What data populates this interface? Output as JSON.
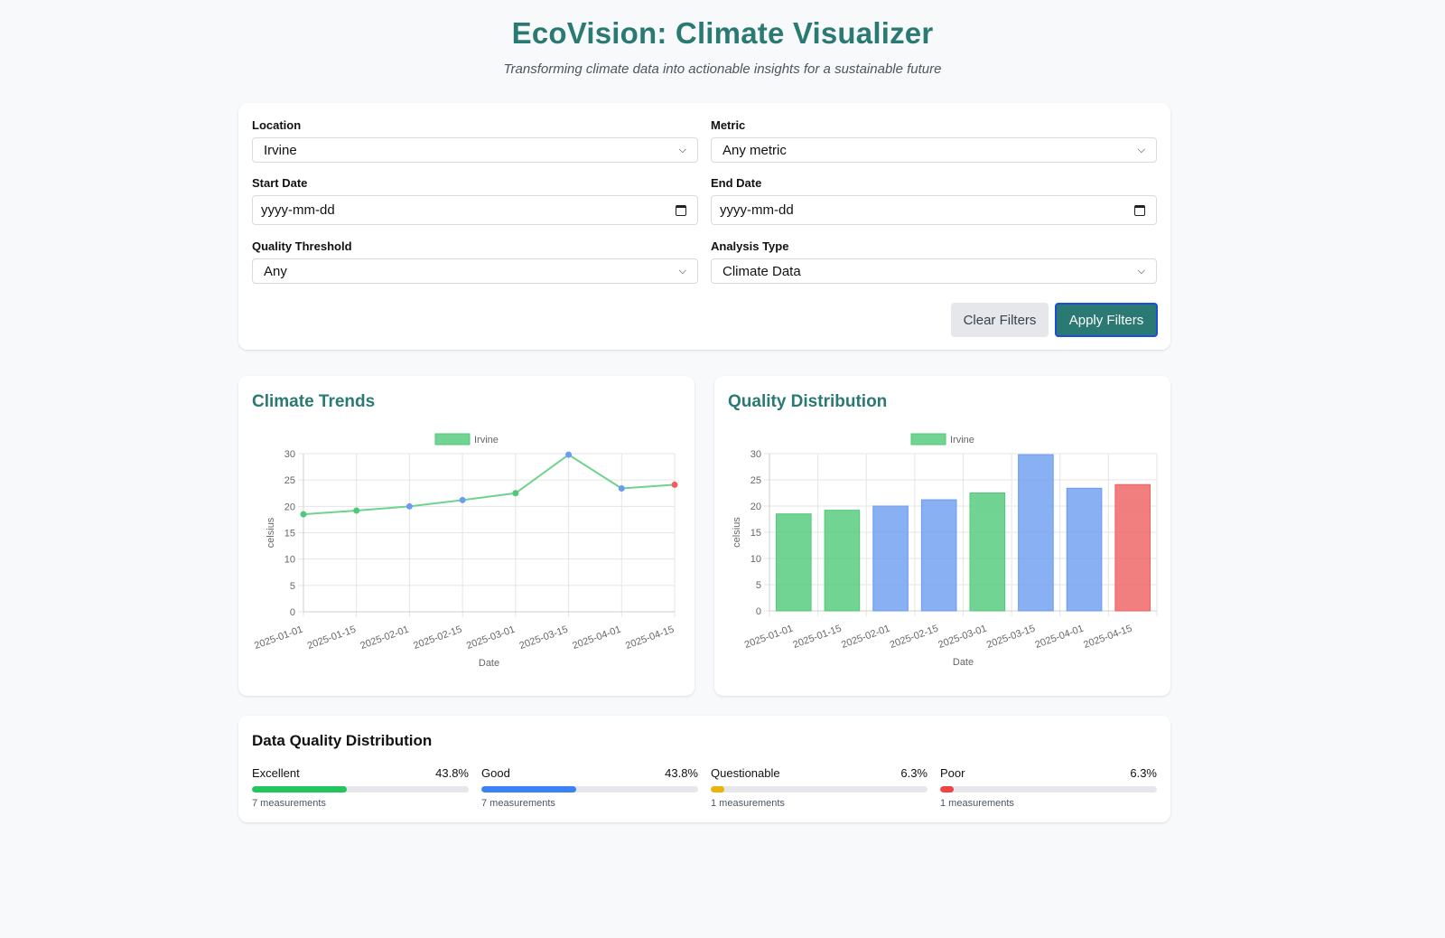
{
  "header": {
    "title": "EcoVision: Climate Visualizer",
    "subtitle": "Transforming climate data into actionable insights for a sustainable future"
  },
  "filters": {
    "location": {
      "label": "Location",
      "value": "Irvine"
    },
    "metric": {
      "label": "Metric",
      "value": "Any metric"
    },
    "start_date": {
      "label": "Start Date",
      "placeholder": "yyyy-mm-dd"
    },
    "end_date": {
      "label": "End Date",
      "placeholder": "yyyy-mm-dd"
    },
    "quality": {
      "label": "Quality Threshold",
      "value": "Any"
    },
    "analysis": {
      "label": "Analysis Type",
      "value": "Climate Data"
    },
    "clear_label": "Clear Filters",
    "apply_label": "Apply Filters"
  },
  "charts": {
    "trends_title": "Climate Trends",
    "quality_title": "Quality Distribution"
  },
  "colors": {
    "excellent": "#4fc978",
    "good": "#6b9cf0",
    "questionable": "#eab308",
    "poor": "#ef5f5f",
    "accent": "#2a7a73"
  },
  "chart_data": [
    {
      "type": "line",
      "title": "Climate Trends",
      "xlabel": "Date",
      "ylabel": "celsius",
      "ylim": [
        0,
        30
      ],
      "yticks": [
        0,
        5,
        10,
        15,
        20,
        25,
        30
      ],
      "legend": "top",
      "grid": true,
      "categories": [
        "2025-01-01",
        "2025-01-15",
        "2025-02-01",
        "2025-02-15",
        "2025-03-01",
        "2025-03-15",
        "2025-04-01",
        "2025-04-15"
      ],
      "series": [
        {
          "name": "Irvine",
          "values": [
            18.5,
            19.2,
            20.0,
            21.2,
            22.5,
            29.8,
            23.4,
            24.1
          ]
        }
      ],
      "point_quality": [
        "excellent",
        "excellent",
        "good",
        "good",
        "excellent",
        "good",
        "good",
        "poor"
      ]
    },
    {
      "type": "bar",
      "title": "Quality Distribution",
      "xlabel": "Date",
      "ylabel": "celsius",
      "ylim": [
        0,
        30
      ],
      "yticks": [
        0,
        5,
        10,
        15,
        20,
        25,
        30
      ],
      "legend": "top",
      "grid": true,
      "categories": [
        "2025-01-01",
        "2025-01-15",
        "2025-02-01",
        "2025-02-15",
        "2025-03-01",
        "2025-03-15",
        "2025-04-01",
        "2025-04-15"
      ],
      "series": [
        {
          "name": "Irvine",
          "values": [
            18.5,
            19.2,
            20.0,
            21.2,
            22.5,
            29.8,
            23.4,
            24.1
          ]
        }
      ],
      "bar_quality": [
        "excellent",
        "excellent",
        "good",
        "good",
        "excellent",
        "good",
        "good",
        "poor"
      ]
    }
  ],
  "data_quality": {
    "title": "Data Quality Distribution",
    "items": [
      {
        "label": "Excellent",
        "percent_text": "43.8%",
        "fraction": 0.438,
        "count_text": "7 measurements",
        "color": "#22c55e"
      },
      {
        "label": "Good",
        "percent_text": "43.8%",
        "fraction": 0.438,
        "count_text": "7 measurements",
        "color": "#3b82f6"
      },
      {
        "label": "Questionable",
        "percent_text": "6.3%",
        "fraction": 0.063,
        "count_text": "1 measurements",
        "color": "#eab308"
      },
      {
        "label": "Poor",
        "percent_text": "6.3%",
        "fraction": 0.063,
        "count_text": "1 measurements",
        "color": "#ef4444"
      }
    ]
  }
}
